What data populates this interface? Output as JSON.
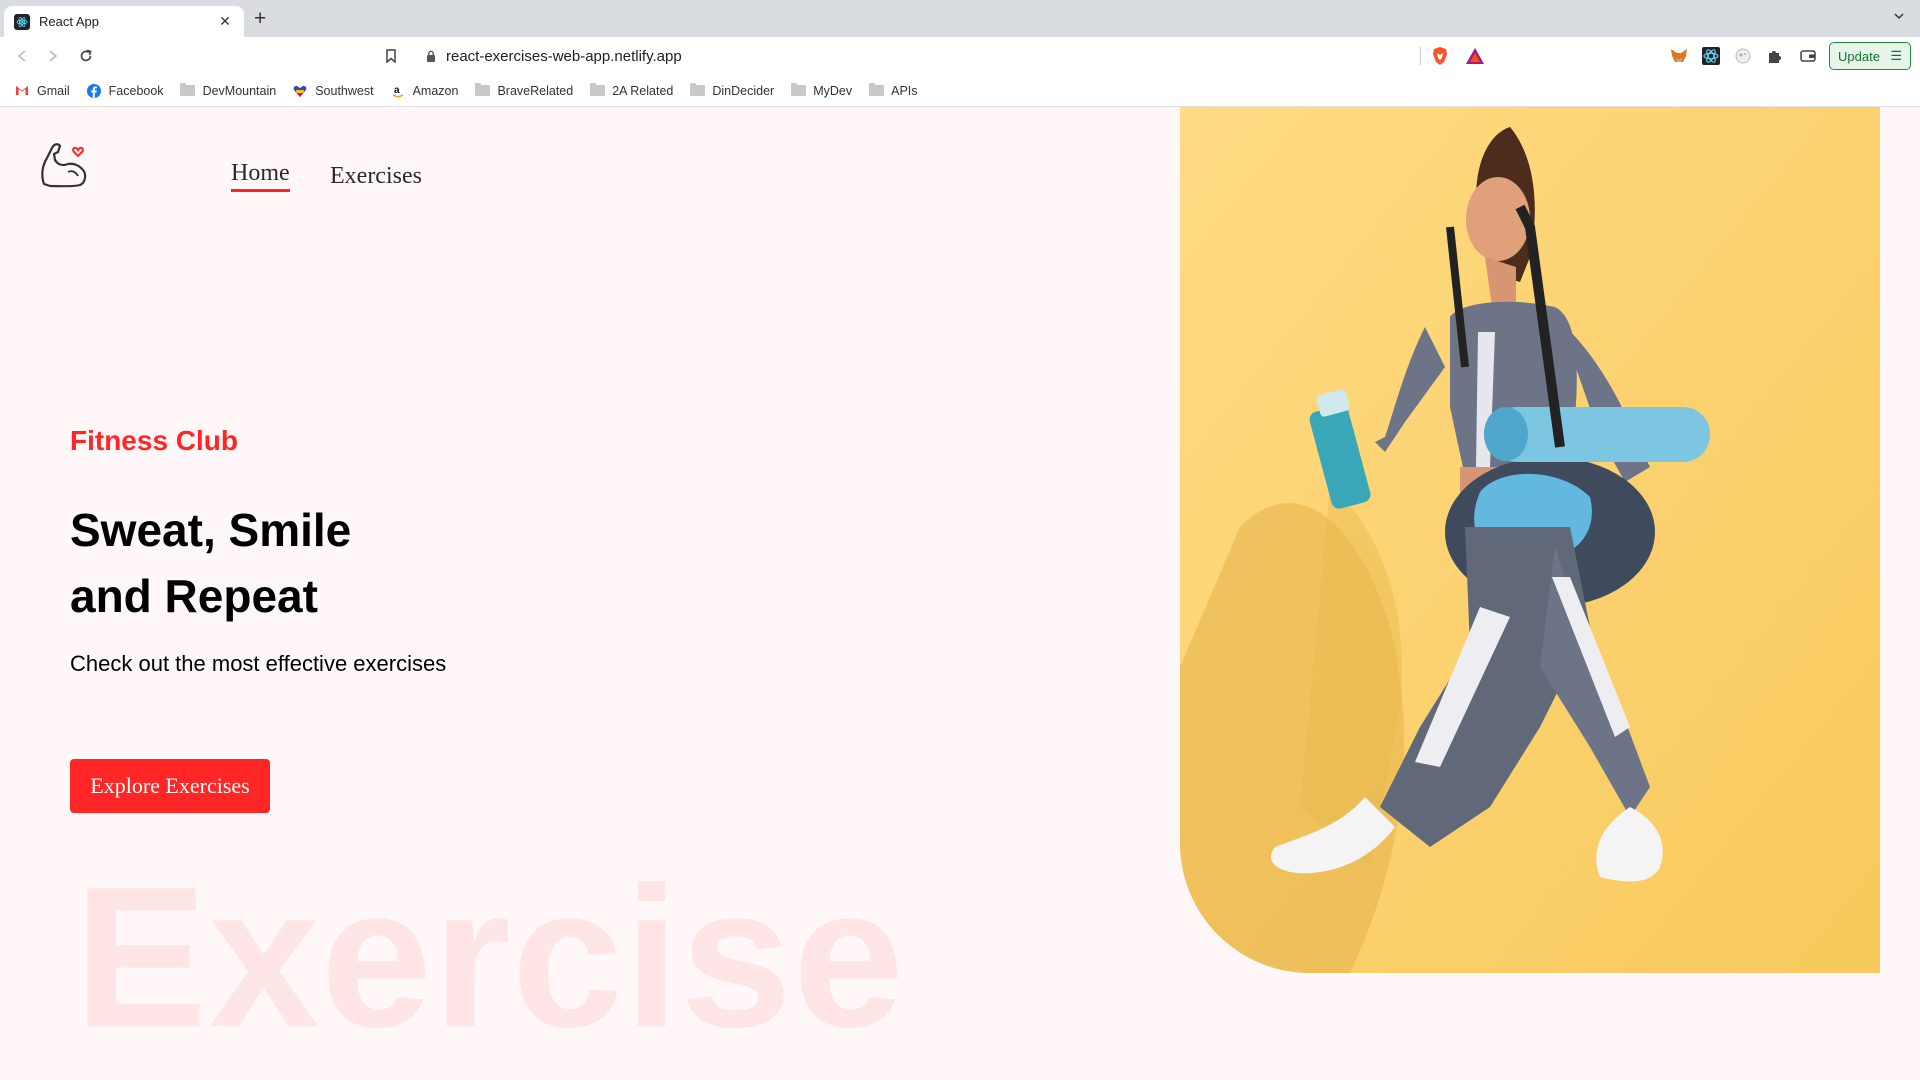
{
  "browser": {
    "tab": {
      "title": "React App"
    },
    "address": {
      "url": "react-exercises-web-app.netlify.app"
    },
    "update_label": "Update",
    "bookmarks": [
      {
        "label": "Gmail",
        "icon": "gmail-icon"
      },
      {
        "label": "Facebook",
        "icon": "facebook-icon"
      },
      {
        "label": "DevMountain",
        "icon": "folder-icon"
      },
      {
        "label": "Southwest",
        "icon": "southwest-icon"
      },
      {
        "label": "Amazon",
        "icon": "amazon-icon"
      },
      {
        "label": "BraveRelated",
        "icon": "folder-icon"
      },
      {
        "label": "2A Related",
        "icon": "folder-icon"
      },
      {
        "label": "DinDecider",
        "icon": "folder-icon"
      },
      {
        "label": "MyDev",
        "icon": "folder-icon"
      },
      {
        "label": "APIs",
        "icon": "folder-icon"
      }
    ]
  },
  "nav": {
    "home": "Home",
    "exercises": "Exercises"
  },
  "hero": {
    "eyebrow": "Fitness Club",
    "headline_line1": "Sweat, Smile",
    "headline_line2": "and Repeat",
    "subtext": "Check out the most effective exercises",
    "cta": "Explore Exercises",
    "watermark": "Exercise"
  },
  "colors": {
    "accent": "#ff2625",
    "page_bg": "#fff7f8",
    "hero_bg": "#fdd572"
  }
}
